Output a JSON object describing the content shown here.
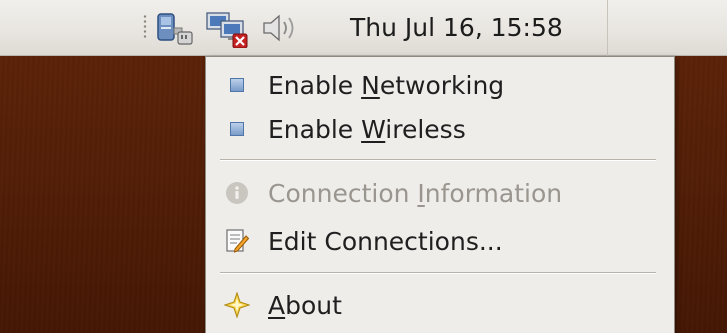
{
  "panel": {
    "clock": "Thu Jul 16, 15:58",
    "tray_icons": [
      {
        "name": "network-manager-icon"
      },
      {
        "name": "network-disconnected-icon"
      },
      {
        "name": "volume-icon"
      }
    ]
  },
  "menu": {
    "items": [
      {
        "label_pre": "Enable ",
        "label_u": "N",
        "label_post": "etworking",
        "checked": true,
        "enabled": true
      },
      {
        "label_pre": "Enable ",
        "label_u": "W",
        "label_post": "ireless",
        "checked": true,
        "enabled": true
      },
      {
        "label_pre": "Connection ",
        "label_u": "I",
        "label_post": "nformation",
        "icon": "info-icon",
        "enabled": false
      },
      {
        "label_pre": "Edit Connections...",
        "label_u": "",
        "label_post": "",
        "icon": "edit-document-icon",
        "enabled": true
      },
      {
        "label_pre": "",
        "label_u": "A",
        "label_post": "bout",
        "icon": "about-star-icon",
        "enabled": true
      }
    ]
  },
  "colors": {
    "desktop": "#521e07",
    "panel": "#e8e5e0",
    "menu_bg": "#efedea",
    "disabled_text": "#9a968f"
  }
}
